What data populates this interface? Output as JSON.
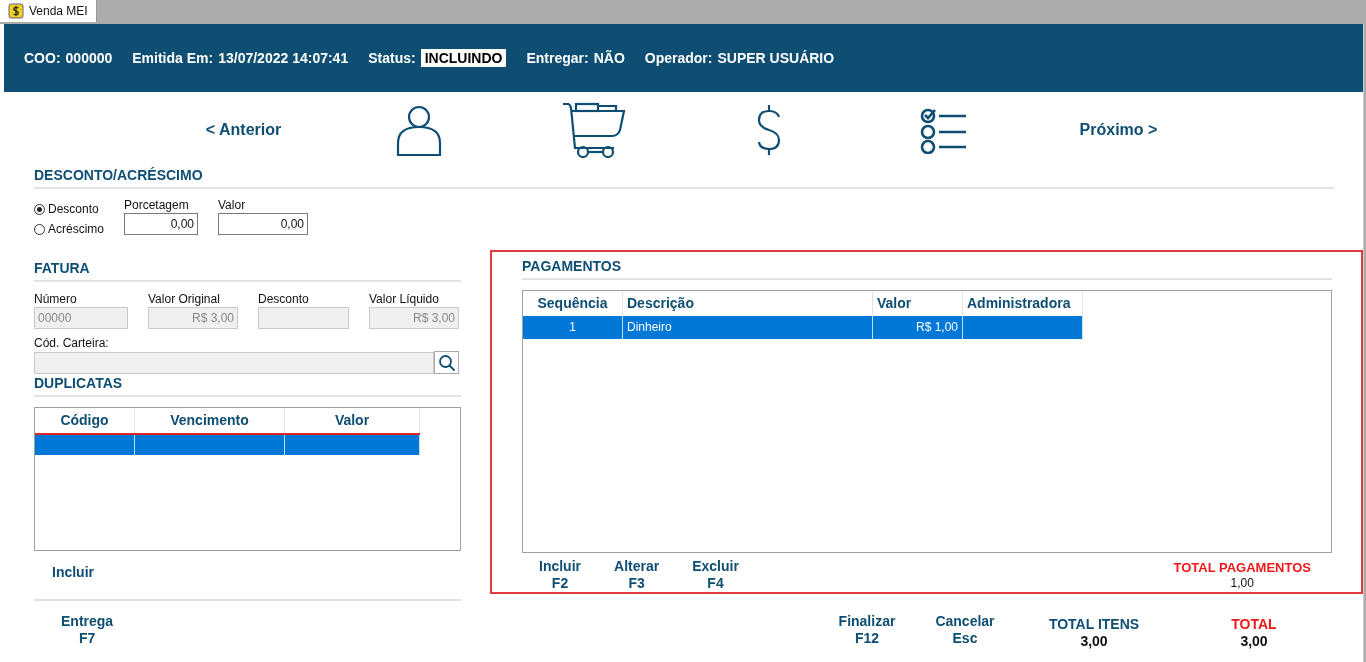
{
  "window": {
    "tab": "Venda MEI"
  },
  "header": [
    {
      "label": "COO:",
      "value": "000000",
      "kind": "plain"
    },
    {
      "label": "Emitida Em:",
      "value": "13/07/2022 14:07:41",
      "kind": "plain"
    },
    {
      "label": "Status:",
      "value": "INCLUINDO",
      "kind": "badge"
    },
    {
      "label": "Entregar:",
      "value": "NÃO",
      "kind": "plain"
    },
    {
      "label": "Operador:",
      "value": "SUPER USUÁRIO",
      "kind": "plain"
    }
  ],
  "nav": {
    "previous": "< Anterior",
    "next": "Próximo >"
  },
  "discount": {
    "title": "DESCONTO/ACRÉSCIMO",
    "options": [
      {
        "label": "Desconto",
        "selected": true
      },
      {
        "label": "Acréscimo",
        "selected": false
      }
    ],
    "fields": [
      {
        "label": "Porcetagem",
        "value": "0,00"
      },
      {
        "label": "Valor",
        "value": "0,00"
      }
    ]
  },
  "invoice": {
    "title": "FATURA",
    "fields": [
      {
        "label": "Número",
        "value": "00000",
        "disabled": true
      },
      {
        "label": "Valor Original",
        "value": "R$ 3,00",
        "disabled": true
      },
      {
        "label": "Desconto",
        "disabled": true
      },
      {
        "label": "Valor Líquido",
        "value": "R$ 3,00",
        "disabled": true
      }
    ],
    "wallet": {
      "label": "Cód. Carteira:",
      "disabled": true
    }
  },
  "duplicates": {
    "title": "DUPLICATAS",
    "columns": [
      "Código",
      "Vencimento",
      "Valor"
    ],
    "rows": [
      {
        "selected": true
      }
    ],
    "action": "Incluir"
  },
  "payments": {
    "title": "PAGAMENTOS",
    "columns": [
      "Sequência",
      "Descrição",
      "Valor",
      "Administradora"
    ],
    "rows": [
      {
        "cells": [
          "1",
          "Dinheiro",
          "R$ 1,00"
        ],
        "selected": true
      }
    ],
    "actions": [
      {
        "label": "Incluir",
        "key": "F2"
      },
      {
        "label": "Alterar",
        "key": "F3"
      },
      {
        "label": "Excluir",
        "key": "F4"
      }
    ],
    "total_label": "TOTAL PAGAMENTOS",
    "total_value": "1,00"
  },
  "footer": {
    "left_action": {
      "label": "Entrega",
      "key": "F7"
    },
    "actions": [
      {
        "label": "Finalizar",
        "key": "F12"
      },
      {
        "label": "Cancelar",
        "key": "Esc"
      }
    ],
    "totals": [
      {
        "label": "TOTAL ITENS",
        "value": "3,00",
        "highlight": false
      },
      {
        "label": "TOTAL",
        "value": "3,00",
        "highlight": true
      }
    ]
  }
}
